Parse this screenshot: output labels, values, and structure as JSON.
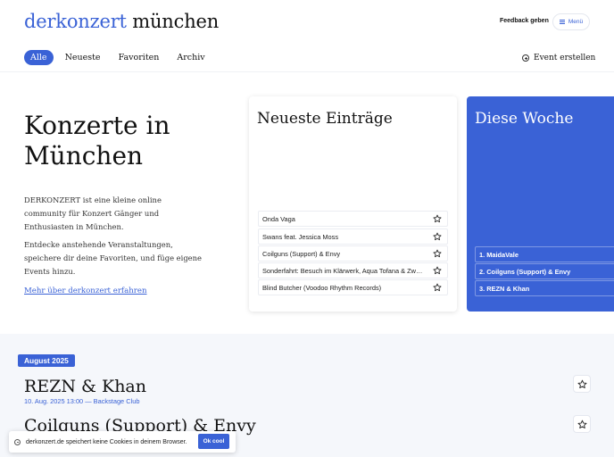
{
  "header": {
    "logo_part1": "derkonzert",
    "logo_part2": "münchen",
    "feedback_label": "Feedback geben",
    "menu_label": "Menü"
  },
  "nav": {
    "tabs": [
      {
        "label": "Alle",
        "active": true
      },
      {
        "label": "Neueste"
      },
      {
        "label": "Favoriten"
      },
      {
        "label": "Archiv"
      }
    ],
    "create_label": "Event erstellen"
  },
  "hero": {
    "title_line1": "Konzerte in",
    "title_line2": "München",
    "paragraph1": "DERKONZERT ist eine kleine online community für Konzert Gänger und Enthusiasten in München.",
    "paragraph2": "Entdecke anstehende Veranstaltungen, speichere dir deine Favoriten, und füge eigene Events hinzu.",
    "link": "Mehr über derkonzert erfahren"
  },
  "latest": {
    "title": "Neueste Einträge",
    "entries": [
      "Onda Vaga",
      "Swans feat. Jessica Moss",
      "Coilguns (Support) & Envy",
      "Sonderfahrt: Besuch im Klärwerk, Aqua Tofana & Zweilaster",
      "Blind Butcher (Voodoo Rhythm Records)"
    ]
  },
  "week": {
    "title": "Diese Woche",
    "items": [
      "1. MaidaVale",
      "2. Coilguns (Support) & Envy",
      "3. REZN & Khan"
    ]
  },
  "events": {
    "month_badge": "August 2025",
    "list": [
      {
        "title": "REZN & Khan",
        "meta": "10. Aug. 2025 13:00 — Backstage Club"
      },
      {
        "title": "Coilguns (Support) & Envy",
        "meta": ""
      }
    ]
  },
  "cookie": {
    "text": "derkonzert.de speichert keine Cookies in deinem Browser.",
    "button": "Ok cool"
  },
  "colors": {
    "accent": "#3a62d6"
  }
}
